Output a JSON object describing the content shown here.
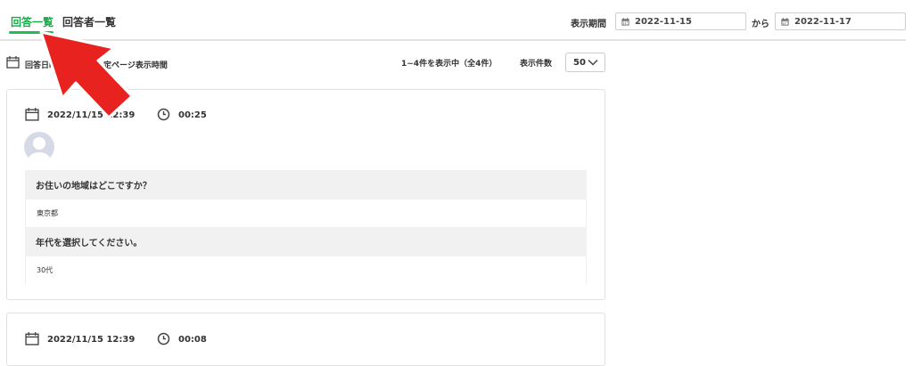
{
  "tabs": [
    {
      "label": "回答一覧",
      "active": true
    },
    {
      "label": "回答者一覧",
      "active": false
    }
  ],
  "period": {
    "label": "表示期間",
    "from": "2022-11-15",
    "separator": "から",
    "to": "2022-11-17"
  },
  "toolbar": {
    "answer_date_label": "回答日時",
    "page_time_label": "定ページ表示時間",
    "count_text": "1~4件を表示中（全4件）",
    "per_page_label": "表示件数",
    "per_page_value": "50"
  },
  "responses": [
    {
      "date": "2022/11/15 12:39",
      "duration": "00:25",
      "qa": [
        {
          "question": "お住いの地域はどこですか？",
          "answer": "東京都"
        },
        {
          "question": "年代を選択してください。",
          "answer": "30代"
        }
      ]
    },
    {
      "date": "2022/11/15 12:39",
      "duration": "00:08"
    }
  ],
  "colors": {
    "accent": "#1aa84a",
    "arrow": "#e8231f"
  }
}
